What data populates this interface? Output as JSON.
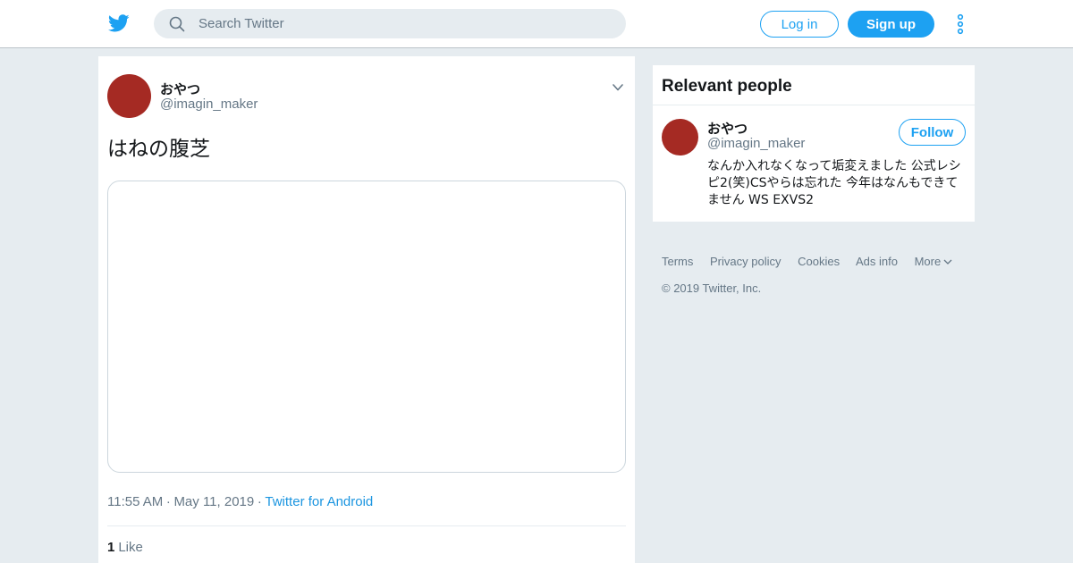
{
  "header": {
    "logo_icon": "twitter-bird-icon",
    "search_placeholder": "Search Twitter",
    "login_label": "Log in",
    "signup_label": "Sign up",
    "more_icon": "vertical-dots-icon"
  },
  "tweet": {
    "author_name": "おやつ",
    "author_handle": "@imagin_maker",
    "text": "はねの腹芝",
    "time": "11:55 AM",
    "date": "May 11, 2019",
    "source": "Twitter for Android",
    "like_count": "1",
    "like_label": "Like"
  },
  "relevant_people": {
    "title": "Relevant people",
    "person": {
      "name": "おやつ",
      "handle": "@imagin_maker",
      "follow_label": "Follow",
      "bio": "なんか入れなくなって垢変えました 公式レシピ2(笑)CSやらは忘れた 今年はなんもできてません WS EXVS2"
    }
  },
  "footer": {
    "links": [
      "Terms",
      "Privacy policy",
      "Cookies",
      "Ads info",
      "More"
    ],
    "copyright": "© 2019 Twitter, Inc."
  },
  "colors": {
    "brand": "#1da1f2",
    "background": "#e6ecf0",
    "avatar": "#a52a23",
    "muted_text": "#657786"
  }
}
